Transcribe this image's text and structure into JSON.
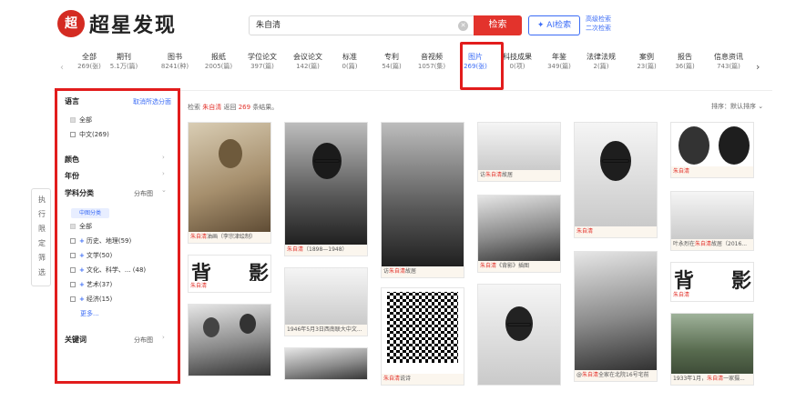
{
  "header": {
    "logo_mark": "超",
    "logo_text": "超星发现",
    "search_value": "朱自清",
    "search_button": "检索",
    "ai_button": "AI检索",
    "advanced_search": "高级检索",
    "secondary_search": "二次检索"
  },
  "categories": [
    {
      "name": "全部",
      "count": "269(张)"
    },
    {
      "name": "期刊",
      "count": "5.1万(篇)"
    },
    {
      "name": "图书",
      "count": "8241(种)"
    },
    {
      "name": "报纸",
      "count": "2005(篇)"
    },
    {
      "name": "学位论文",
      "count": "397(篇)"
    },
    {
      "name": "会议论文",
      "count": "142(篇)"
    },
    {
      "name": "标准",
      "count": "0(篇)"
    },
    {
      "name": "专利",
      "count": "54(篇)"
    },
    {
      "name": "音视频",
      "count": "1057(集)"
    },
    {
      "name": "图片",
      "count": "269(张)"
    },
    {
      "name": "科技成果",
      "count": "0(项)"
    },
    {
      "name": "年鉴",
      "count": "349(篇)"
    },
    {
      "name": "法律法规",
      "count": "2(篇)"
    },
    {
      "name": "案例",
      "count": "23(篇)"
    },
    {
      "name": "报告",
      "count": "36(篇)"
    },
    {
      "name": "信息资讯",
      "count": "743(篇)"
    }
  ],
  "sidebar": {
    "language_title": "语言",
    "clear_filter": "取消所选分面",
    "lang_all": "全部",
    "lang_zh": "中文(269)",
    "color_title": "颜色",
    "year_title": "年份",
    "subject_title": "学科分类",
    "distribution": "分布图",
    "cn_map_tag": "中图分类",
    "subject_all": "全部",
    "subjects": [
      "历史、地理(59)",
      "文学(50)",
      "文化、科学、... (48)",
      "艺术(37)",
      "经济(15)"
    ],
    "more": "更多...",
    "keyword_title": "关键词",
    "keyword_distribution": "分布图"
  },
  "side_tab": [
    "执",
    "行",
    "限",
    "定",
    "筛",
    "选"
  ],
  "results": {
    "prefix": "检索",
    "query": "朱自清",
    "middle": "返回",
    "count": "269",
    "suffix": "条结果。",
    "sort": "排序：默认排序"
  },
  "captions": {
    "c1": "朱自清油画（李宗津绘制）",
    "c2": "朱自清（1898—1948）",
    "c3": "访朱自清故居",
    "c4": "朱自清",
    "c5": "朱自清",
    "c6": "叶永烈在朱自清故居（2016...",
    "c7": "朱自清《背影》插图",
    "c8": "访朱自清故居",
    "c9": "朱自清",
    "c10": "1946年5月3日西南联大中文...",
    "c11": "朱自清",
    "c12": "朱自清说诗",
    "c13": "@朱自清全家在北院16号宅前",
    "c14": "1933年1月，朱自清一家摄..."
  },
  "beiying": {
    "a": "背",
    "b": "影"
  }
}
